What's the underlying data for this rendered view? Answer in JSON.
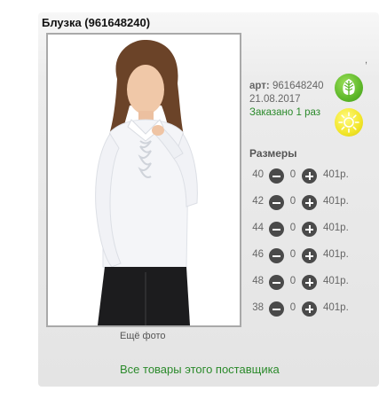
{
  "product": {
    "title": "Блузка (961648240)",
    "article_label": "арт:",
    "article_value": "961648240",
    "date": "21.08.2017",
    "ordered": "Заказано 1 раз",
    "tick": ","
  },
  "photo": {
    "more_label": "Ещё фото"
  },
  "sizes": {
    "title": "Размеры",
    "rows": [
      {
        "size": "40",
        "qty": "0",
        "price": "401р."
      },
      {
        "size": "42",
        "qty": "0",
        "price": "401р."
      },
      {
        "size": "44",
        "qty": "0",
        "price": "401р."
      },
      {
        "size": "46",
        "qty": "0",
        "price": "401р."
      },
      {
        "size": "48",
        "qty": "0",
        "price": "401р."
      },
      {
        "size": "38",
        "qty": "0",
        "price": "401р."
      }
    ]
  },
  "footer": {
    "all_goods_link": "Все товары этого поставщика"
  },
  "icons": {
    "badge_leaf": "leaf-icon",
    "badge_sun": "sun-icon"
  },
  "colors": {
    "green_text": "#2b8a2b",
    "leaf_badge": "#5fb82a",
    "sun_badge": "#f2e62a"
  }
}
